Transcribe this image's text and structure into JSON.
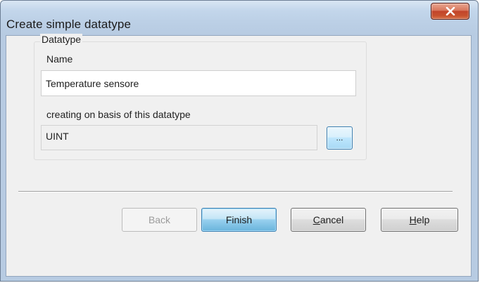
{
  "window": {
    "title": "Create simple datatype"
  },
  "group": {
    "legend": "Datatype",
    "name_label": "Name",
    "name_value": "Temperature sensore",
    "base_label": "creating on basis of this datatype",
    "base_value": "UINT",
    "browse_label": "..."
  },
  "buttons": {
    "back": "Back",
    "finish": "Finish",
    "cancel_first": "C",
    "cancel_rest": "ancel",
    "help_first": "H",
    "help_rest": "elp"
  },
  "colors": {
    "title_gradient_top": "#d9e6f3",
    "close_button": "#c7532f",
    "default_button": "#98d1ef"
  },
  "icons": {
    "close": "close-x-icon"
  }
}
